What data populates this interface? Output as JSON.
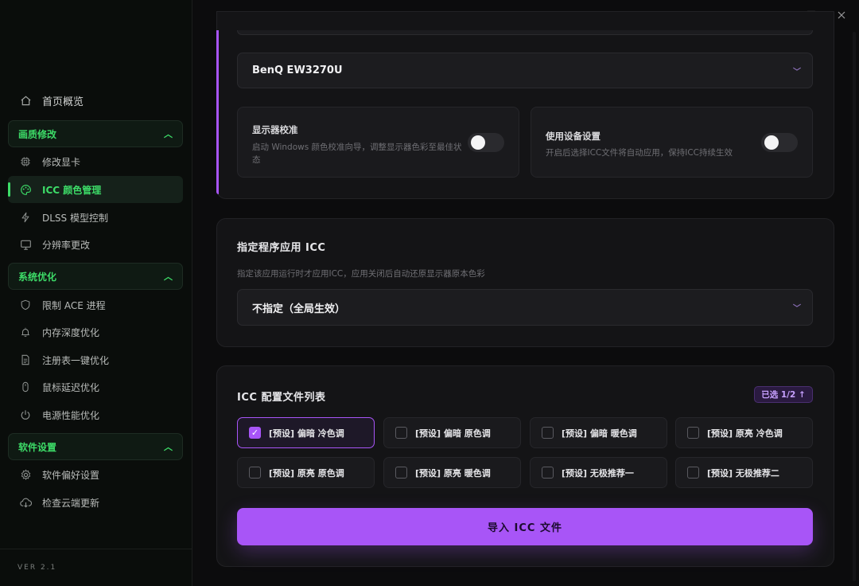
{
  "sidebar": {
    "home": "首页概览",
    "groups": [
      {
        "label": "画质修改",
        "chevron": "chevron-up-icon"
      },
      {
        "label": "系统优化",
        "chevron": "chevron-up-icon"
      },
      {
        "label": "软件设置",
        "chevron": "chevron-up-icon"
      }
    ],
    "items": [
      {
        "label": "修改显卡",
        "icon": "chip-icon"
      },
      {
        "label": "ICC 颜色管理",
        "icon": "palette-icon",
        "active": true
      },
      {
        "label": "DLSS 模型控制",
        "icon": "lightning-icon"
      },
      {
        "label": "分辨率更改",
        "icon": "monitor-icon"
      },
      {
        "label": "限制 ACE 进程",
        "icon": "shield-icon"
      },
      {
        "label": "内存深度优化",
        "icon": "alarm-icon"
      },
      {
        "label": "注册表一键优化",
        "icon": "document-icon"
      },
      {
        "label": "鼠标延迟优化",
        "icon": "mouse-icon"
      },
      {
        "label": "电源性能优化",
        "icon": "power-icon"
      },
      {
        "label": "软件偏好设置",
        "icon": "gear-icon"
      },
      {
        "label": "检查云端更新",
        "icon": "cloud-download-icon"
      }
    ],
    "version": "VER 2.1"
  },
  "window": {
    "minimize": "—",
    "maximize": "☐",
    "close": "✕"
  },
  "monitor_card": {
    "selected_monitor": "BenQ EW3270U",
    "calibration": {
      "title": "显示器校准",
      "desc": "启动 Windows 颜色校准向导，调整显示器色彩至最佳状态",
      "enabled": false
    },
    "device_settings": {
      "title": "使用设备设置",
      "desc": "开启后选择ICC文件将自动应用，保持ICC持续生效",
      "enabled": false
    }
  },
  "app_card": {
    "title": "指定程序应用 ICC",
    "desc": "指定该应用运行时才应用ICC，应用关闭后自动还原显示器原本色彩",
    "selected": "不指定（全局生效）"
  },
  "profiles_card": {
    "title": "ICC 配置文件列表",
    "badge": "已选 1/2 ↑",
    "profiles": [
      {
        "label": "[预设] 偏暗 冷色调",
        "checked": true
      },
      {
        "label": "[预设] 偏暗 原色调",
        "checked": false
      },
      {
        "label": "[预设] 偏暗 暖色调",
        "checked": false
      },
      {
        "label": "[预设] 原亮 冷色调",
        "checked": false
      },
      {
        "label": "[预设] 原亮 原色调",
        "checked": false
      },
      {
        "label": "[预设] 原亮 暖色调",
        "checked": false
      },
      {
        "label": "[预设] 无极推荐一",
        "checked": false
      },
      {
        "label": "[预设] 无极推荐二",
        "checked": false
      }
    ],
    "import_button": "导入 ICC 文件"
  },
  "colors": {
    "accent_green": "#3ddc68",
    "accent_purple": "#a855f7"
  }
}
